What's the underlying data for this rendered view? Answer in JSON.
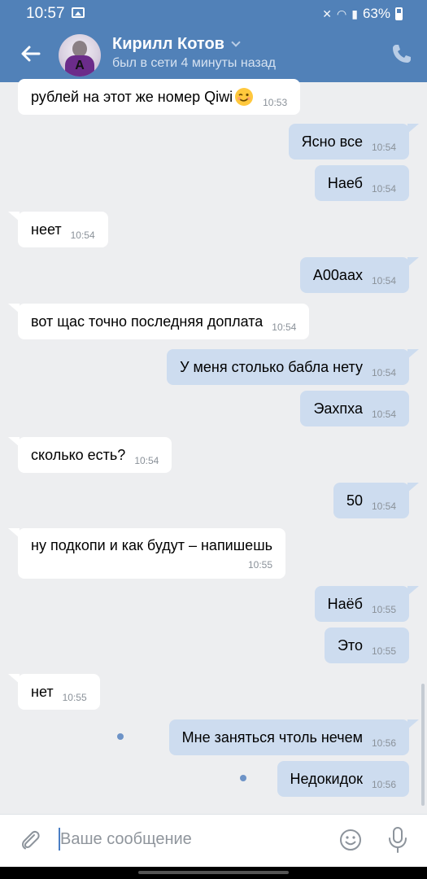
{
  "status_bar": {
    "time": "10:57",
    "battery": "63%"
  },
  "header": {
    "contact_name": "Кирилл Котов",
    "last_seen": "был в сети 4 минуты назад",
    "avatar_letter": "A"
  },
  "messages": [
    {
      "dir": "in",
      "text": "рублей на этот же номер Qiwi",
      "emoji": "wink",
      "time": "10:53"
    },
    {
      "dir": "out",
      "text": "Ясно все",
      "time": "10:54"
    },
    {
      "dir": "out",
      "text": "Наеб",
      "time": "10:54"
    },
    {
      "dir": "in",
      "text": "неет",
      "time": "10:54"
    },
    {
      "dir": "out",
      "text": "А00аах",
      "time": "10:54"
    },
    {
      "dir": "in",
      "text": "вот щас точно последняя доплата",
      "time": "10:54"
    },
    {
      "dir": "out",
      "text": "У меня столько бабла нету",
      "time": "10:54"
    },
    {
      "dir": "out",
      "text": "Эахпха",
      "time": "10:54"
    },
    {
      "dir": "in",
      "text": "сколько есть?",
      "time": "10:54"
    },
    {
      "dir": "out",
      "text": "50",
      "time": "10:54"
    },
    {
      "dir": "in",
      "text": "ну подкопи и как будут – напишешь",
      "time": "10:55"
    },
    {
      "dir": "out",
      "text": "Наёб",
      "time": "10:55"
    },
    {
      "dir": "out",
      "text": "Это",
      "time": "10:55"
    },
    {
      "dir": "in",
      "text": "нет",
      "time": "10:55"
    },
    {
      "dir": "out",
      "text": "Мне заняться чтоль нечем",
      "time": "10:56",
      "unread": true
    },
    {
      "dir": "out",
      "text": "Недокидок",
      "time": "10:56",
      "unread": true
    }
  ],
  "composer": {
    "placeholder": "Ваше сообщение",
    "value": ""
  },
  "colors": {
    "header_bg": "#5181b8",
    "outgoing_bubble": "#cddcef",
    "incoming_bubble": "#ffffff",
    "chat_bg": "#edeef0"
  },
  "icons": [
    "back-arrow-icon",
    "call-icon",
    "attach-icon",
    "emoji-icon",
    "microphone-icon"
  ]
}
